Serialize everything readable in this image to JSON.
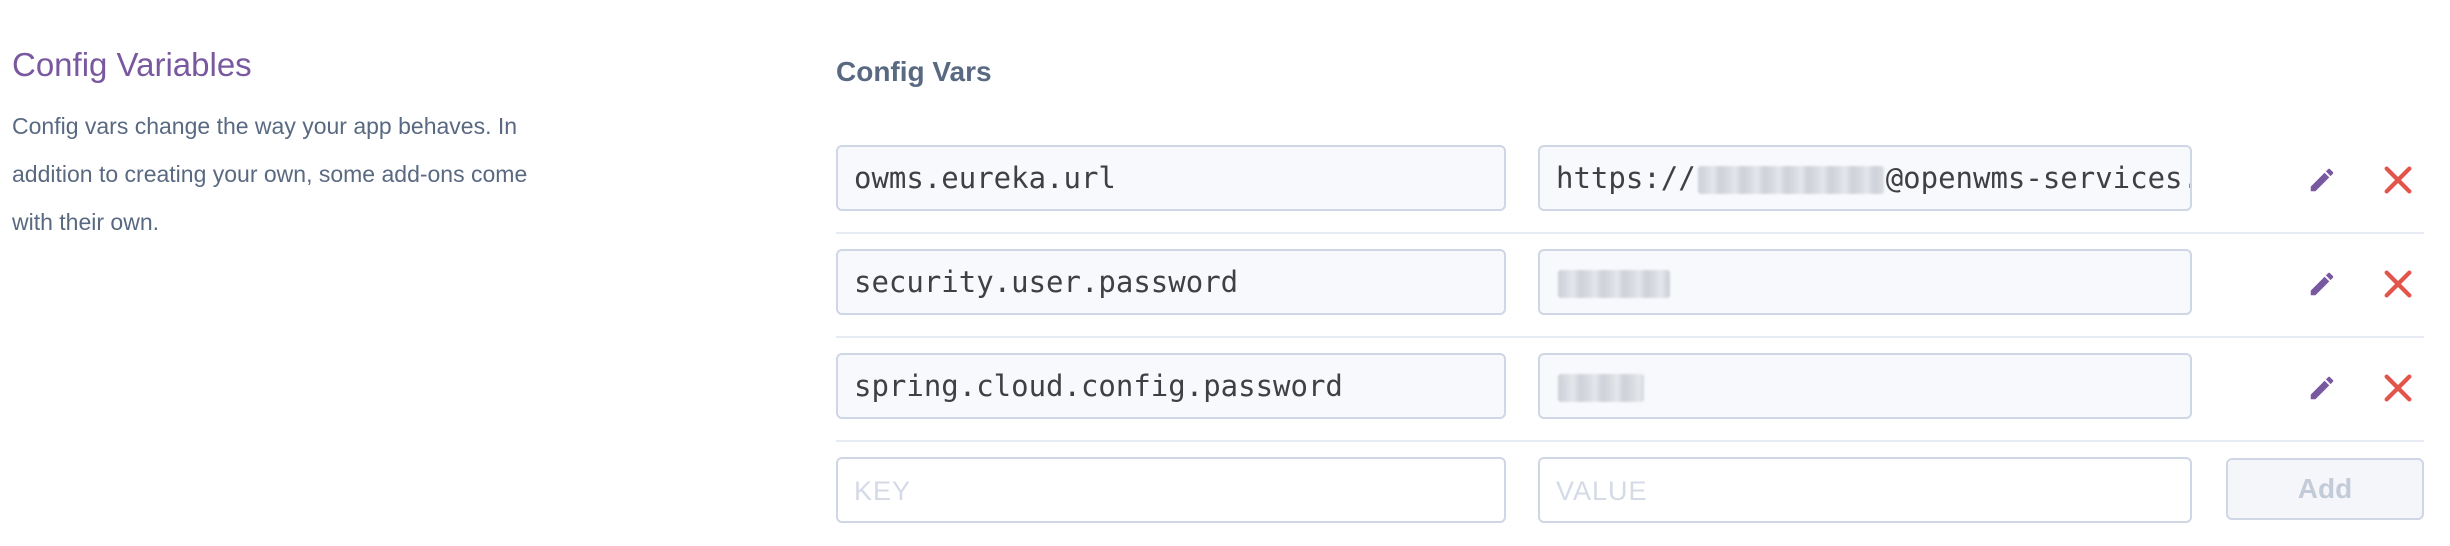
{
  "section": {
    "title": "Config Variables",
    "description": "Config vars change the way your app behaves. In addition to creating your own, some add-ons come with their own."
  },
  "panel": {
    "title": "Config Vars"
  },
  "vars": [
    {
      "key": "owms.eureka.url",
      "value_prefix": "https://",
      "value_suffix": "@openwms-services.h",
      "masked": true
    },
    {
      "key": "security.user.password",
      "masked": true
    },
    {
      "key": "spring.cloud.config.password",
      "masked": true
    }
  ],
  "new_var": {
    "key_placeholder": "KEY",
    "value_placeholder": "VALUE",
    "add_label": "Add"
  },
  "icons": {
    "edit": "pencil-icon",
    "delete": "close-icon"
  },
  "colors": {
    "accent": "#79589f",
    "delete": "#e3554a",
    "text": "#596981"
  }
}
